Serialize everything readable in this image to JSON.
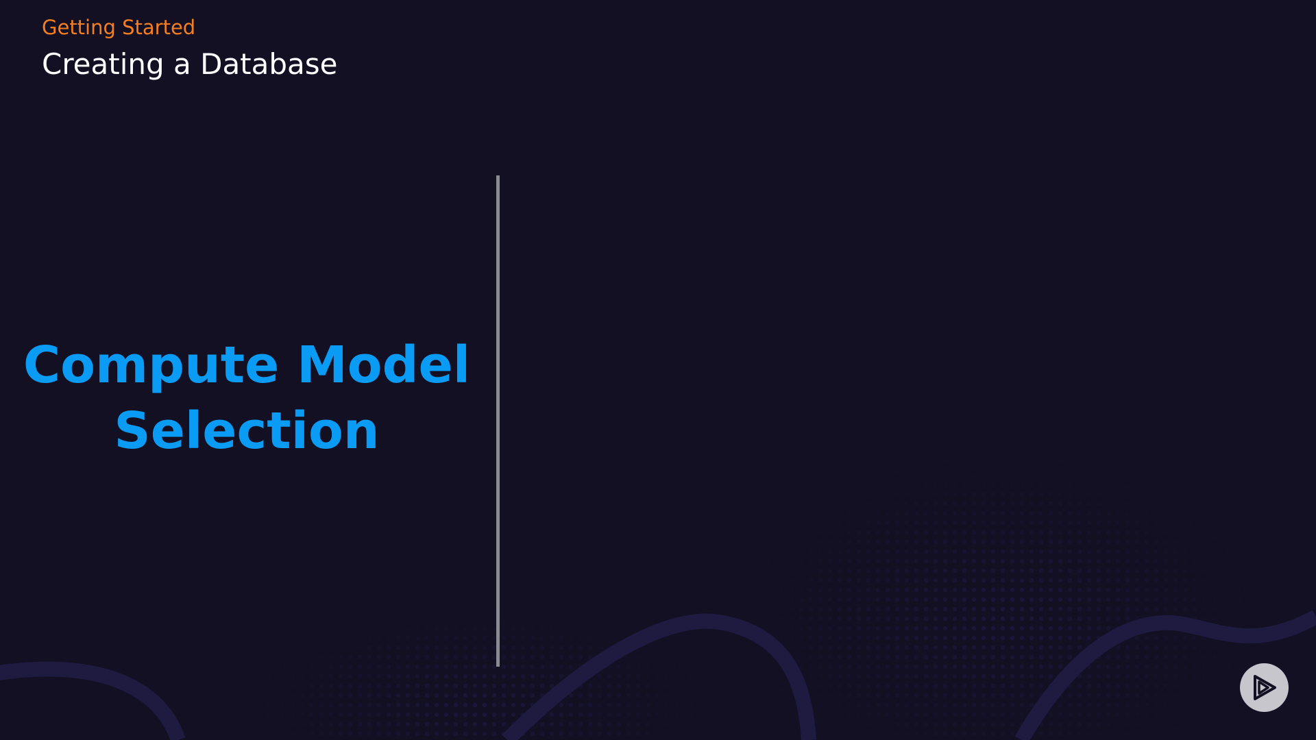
{
  "header": {
    "course": "Getting Started",
    "module": "Creating a Database"
  },
  "main": {
    "section_title": "Compute Model Selection"
  },
  "footer": {
    "play_icon": "play-logo-icon"
  },
  "colors": {
    "background": "#131024",
    "course_text": "#f57f20",
    "module_text": "#ffffff",
    "section_title": "#0a9cf5",
    "divider": "#8a8a92",
    "wave": "#1e1a40",
    "button_bg": "#c6c6cc"
  }
}
